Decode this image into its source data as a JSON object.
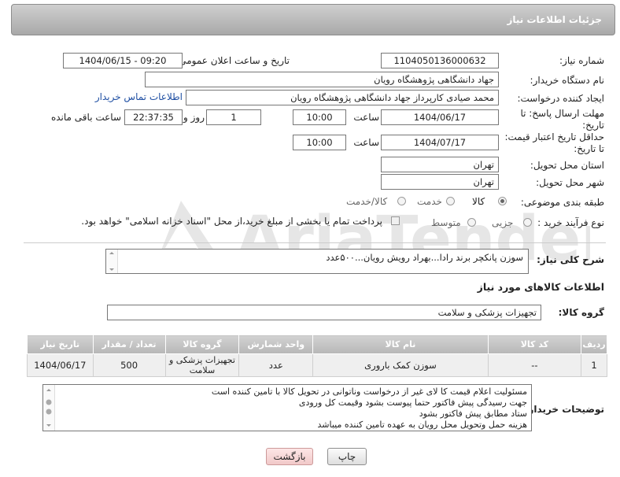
{
  "header": {
    "title": "جزئیات اطلاعات نیاز"
  },
  "labels": {
    "need_number": "شماره نیاز:",
    "public_announce": "تاریخ و ساعت اعلان عمومی:",
    "buyer_org": "نام دستگاه خریدار:",
    "requester": "ایجاد کننده درخواست:",
    "reply_deadline": "مهلت ارسال پاسخ: تا تاریخ:",
    "price_validity": "حداقل تاریخ اعتبار قیمت: تا تاریخ:",
    "time": "ساعت",
    "days_and": "روز و",
    "remaining": "ساعت باقی مانده",
    "province": "استان محل تحویل:",
    "city": "شهر محل تحویل:",
    "category": "طبقه بندی موضوعی:",
    "process_type": "نوع فرآیند خرید :",
    "general_desc": "شرح کلی نیاز:",
    "goods_info": "اطلاعات کالاهای مورد نیاز",
    "goods_group": "گروه کالا:",
    "buyer_notes": "توضیحات خریدار:"
  },
  "fields": {
    "need_number": "1104050136000632",
    "public_announce": "1404/06/15 - 09:20",
    "buyer_org": "جهاد دانشگاهی پژوهشگاه رویان",
    "requester": "محمد صیادی کارپرداز جهاد دانشگاهی پژوهشگاه رویان",
    "contact_link": "اطلاعات تماس خریدار",
    "reply_date": "1404/06/17",
    "reply_time": "10:00",
    "days": "1",
    "remaining_time": "22:37:35",
    "validity_date": "1404/07/17",
    "validity_time": "10:00",
    "province": "تهران",
    "city": "تهران",
    "general_desc": "سوزن پانکچر برند رادا...بهراد رویش رویان...۵۰۰عدد",
    "goods_group": "تجهیزات پزشکی و سلامت"
  },
  "category_options": [
    {
      "label": "کالا",
      "selected": true
    },
    {
      "label": "خدمت",
      "selected": false
    },
    {
      "label": "کالا/خدمت",
      "selected": false
    }
  ],
  "process_options": [
    {
      "label": "جزیی",
      "selected": false
    },
    {
      "label": "متوسط",
      "selected": false
    }
  ],
  "payment_note": "پرداخت تمام یا بخشی از مبلغ خرید،از محل \"اسناد خزانه اسلامی\" خواهد بود.",
  "table": {
    "headers": [
      "ردیف",
      "کد کالا",
      "نام کالا",
      "واحد شمارش",
      "گروه کالا",
      "تعداد / مقدار",
      "تاریخ نیاز"
    ],
    "rows": [
      [
        "1",
        "--",
        "سوزن کمک باروری",
        "عدد",
        "تجهیزات پزشکی و سلامت",
        "500",
        "1404/06/17"
      ]
    ]
  },
  "notes": [
    "مسئولیت اعلام قیمت کا لای  غیر از درخواست وناتوانی در تحویل کالا با تامین کننده است",
    "جهت رسیدگی پیش فاکتور حتما پیوست بشود وقیمت کل ورودی",
    "ستاد مطابق پیش فاکتور بشود",
    "هزینه حمل وتحویل محل رویان به عهده تامین کننده میباشد"
  ],
  "buttons": {
    "print": "چاپ",
    "back": "بازگشت"
  },
  "colors": {
    "header_bg": "#b5b5b5",
    "back_button_bg": "#f6d3d3",
    "link": "#1f4fa3"
  },
  "watermark": {
    "brand": "AriaTender.neT"
  }
}
